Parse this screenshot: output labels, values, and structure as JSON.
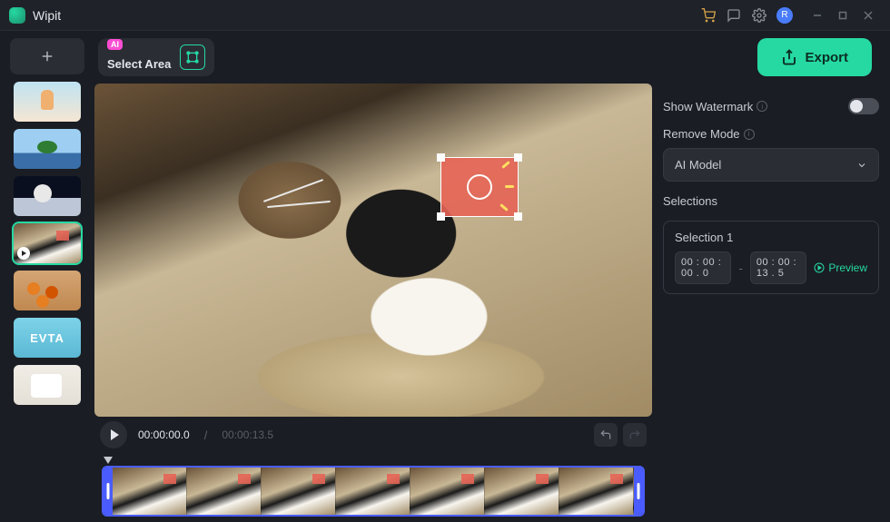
{
  "app": {
    "name": "Wipit",
    "user_initial": "R"
  },
  "toolbar": {
    "ai_badge": "AI",
    "select_area_label": "Select Area",
    "export_label": "Export"
  },
  "playback": {
    "current_time": "00:00:00.0",
    "total_time": "00:00:13.5"
  },
  "panel": {
    "show_watermark_label": "Show Watermark",
    "show_watermark_on": false,
    "remove_mode_label": "Remove Mode",
    "remove_mode_value": "AI Model",
    "selections_label": "Selections",
    "selections": [
      {
        "title": "Selection 1",
        "start": "00 : 00 : 00 . 0",
        "end": "00 : 00 : 13 . 5",
        "preview_label": "Preview"
      }
    ]
  },
  "sidebar": {
    "thumbs": [
      {
        "id": "t1",
        "selected": false
      },
      {
        "id": "t2",
        "selected": false
      },
      {
        "id": "t3",
        "selected": false
      },
      {
        "id": "t4",
        "selected": true
      },
      {
        "id": "t5",
        "selected": false
      },
      {
        "id": "t6",
        "selected": false
      },
      {
        "id": "t7",
        "selected": false
      }
    ]
  },
  "timeline": {
    "frame_count": 7
  }
}
